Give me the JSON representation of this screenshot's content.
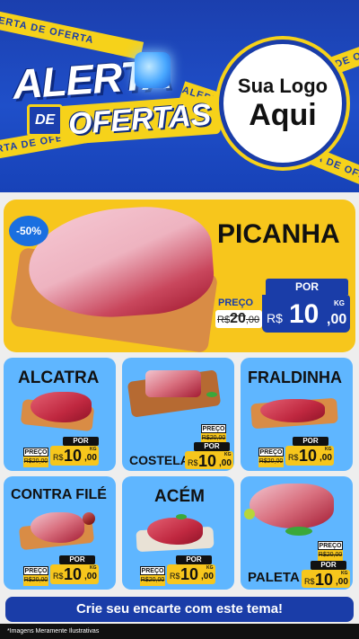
{
  "header": {
    "title_line1": "ALERTA",
    "title_de": "DE",
    "title_line2": "OFERTAS",
    "tape_text": "ALERTA DE OFERTA",
    "logo_line1": "Sua Logo",
    "logo_line2": "Aqui"
  },
  "featured": {
    "name": "PICANHA",
    "discount": "-50%",
    "preco_label": "PREÇO",
    "por_label": "POR",
    "old_currency": "R$",
    "old_int": "20",
    "old_dec": ",00",
    "currency": "R$",
    "price_int": "10",
    "price_dec": ",00",
    "unit": "KG"
  },
  "products": [
    {
      "name": "ALCATRA",
      "preco_label": "PREÇO",
      "por_label": "POR",
      "old_price": "R$20,00",
      "currency": "R$",
      "price_int": "10",
      "price_dec": ",00",
      "unit": "KG"
    },
    {
      "name": "COSTELA",
      "preco_label": "PREÇO",
      "por_label": "POR",
      "old_price": "R$20,00",
      "currency": "R$",
      "price_int": "10",
      "price_dec": ",00",
      "unit": "KG"
    },
    {
      "name": "FRALDINHA",
      "preco_label": "PREÇO",
      "por_label": "POR",
      "old_price": "R$20,00",
      "currency": "R$",
      "price_int": "10",
      "price_dec": ",00",
      "unit": "KG"
    },
    {
      "name": "CONTRA FILÉ",
      "preco_label": "PREÇO",
      "por_label": "POR",
      "old_price": "R$20,00",
      "currency": "R$",
      "price_int": "10",
      "price_dec": ",00",
      "unit": "KG"
    },
    {
      "name": "ACÉM",
      "preco_label": "PREÇO",
      "por_label": "POR",
      "old_price": "R$20,00",
      "currency": "R$",
      "price_int": "10",
      "price_dec": ",00",
      "unit": "KG"
    },
    {
      "name": "PALETA",
      "preco_label": "PREÇO",
      "por_label": "POR",
      "old_price": "R$20,00",
      "currency": "R$",
      "price_int": "10",
      "price_dec": ",00",
      "unit": "KG"
    }
  ],
  "cta": {
    "label": "Crie seu encarte com este tema!"
  },
  "footnote": "*Imagens Meramente Ilustrativas",
  "colors": {
    "brand_blue": "#1a3da8",
    "brand_yellow": "#f7c61c",
    "card_blue": "#5fb6ff"
  }
}
